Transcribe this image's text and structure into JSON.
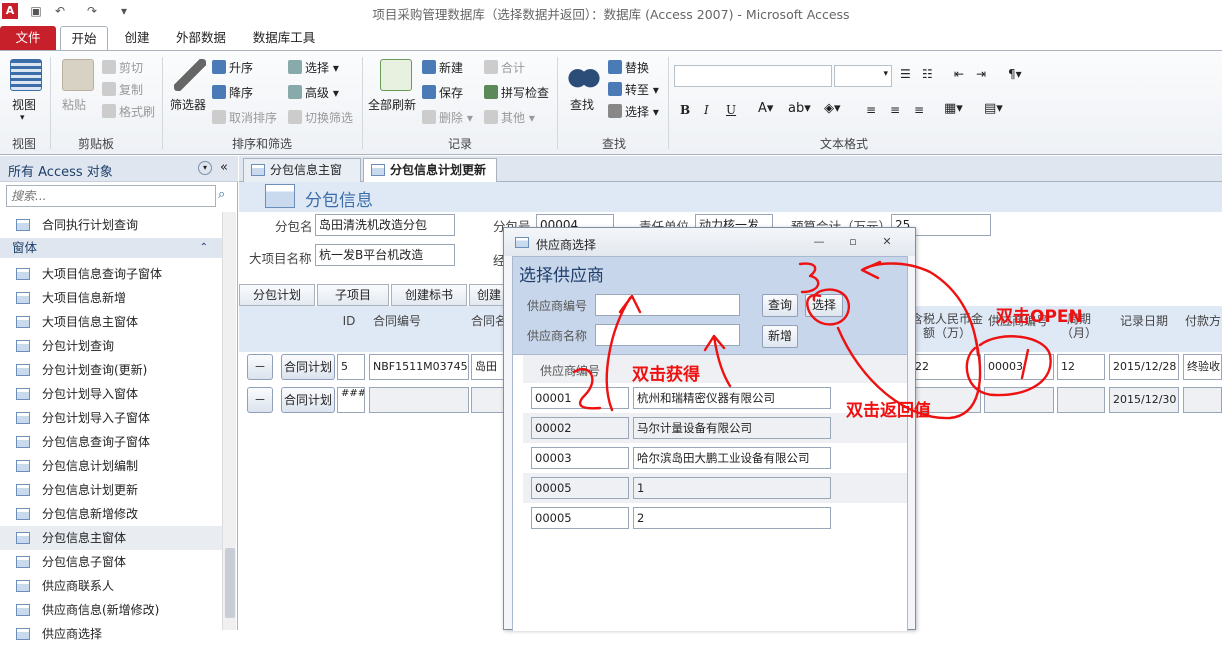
{
  "window": {
    "title": "项目采购管理数据库（选择数据并返回）：数据库 (Access 2007) - Microsoft Access"
  },
  "ribbon_tabs": [
    "文件",
    "开始",
    "创建",
    "外部数据",
    "数据库工具"
  ],
  "ribbon": {
    "view": {
      "label": "视图",
      "group": "视图"
    },
    "clipboard": {
      "paste": "粘贴",
      "cut": "剪切",
      "copy": "复制",
      "format_painter": "格式刷",
      "group": "剪贴板"
    },
    "sort_filter": {
      "filter": "筛选器",
      "asc": "升序",
      "desc": "降序",
      "remove_sort": "取消排序",
      "select": "选择",
      "advanced": "高级",
      "toggle_filter": "切换筛选",
      "group": "排序和筛选"
    },
    "records": {
      "refresh_all": "全部刷新",
      "new": "新建",
      "save": "保存",
      "delete": "删除",
      "totals": "合计",
      "spelling": "拼写检查",
      "more": "其他",
      "group": "记录"
    },
    "find": {
      "find": "查找",
      "replace": "替换",
      "goto": "转至",
      "select": "选择",
      "group": "查找"
    },
    "text_format": {
      "bold": "B",
      "italic": "I",
      "underline": "U",
      "group": "文本格式"
    }
  },
  "nav": {
    "header": "所有 Access 对象",
    "search_placeholder": "搜索...",
    "top_item": "合同执行计划查询",
    "section": "窗体",
    "items": [
      "大项目信息查询子窗体",
      "大项目信息新增",
      "大项目信息主窗体",
      "分包计划查询",
      "分包计划查询(更新)",
      "分包计划导入窗体",
      "分包计划导入子窗体",
      "分包信息查询子窗体",
      "分包信息计划编制",
      "分包信息计划更新",
      "分包信息新增修改",
      "分包信息主窗体",
      "分包信息子窗体",
      "供应商联系人",
      "供应商信息(新增修改)",
      "供应商选择"
    ]
  },
  "doc_tabs": [
    "分包信息主窗体",
    "分包信息计划更新"
  ],
  "form": {
    "title": "分包信息",
    "fields": {
      "sub_name_label": "分包名",
      "sub_name": "岛田清洗机改造分包",
      "sub_no_label": "分包号",
      "sub_no": "00004",
      "dept_label": "责任单位",
      "dept": "动力核一发",
      "budget_label": "预算合计（万元）",
      "budget": "25",
      "project_label": "大项目名称",
      "project": "杭一发B平台机改造",
      "partial_label": "经"
    },
    "buttons": [
      "分包计划",
      "子项目",
      "创建标书",
      "创建"
    ],
    "grid_headers": {
      "id": "ID",
      "contract_no": "合同编号",
      "contract_name": "合同名",
      "amount": "含税人民币金额（万）",
      "supplier_no": "供应商编号",
      "period": "周期（月）",
      "record_date": "记录日期",
      "payment": "付款方"
    },
    "rows": [
      {
        "minus": "－",
        "btn": "合同计划",
        "id": "5",
        "contract_no": "NBF1511M03745",
        "contract_name": "岛田",
        "amount": "22",
        "supplier_no": "00003",
        "period": "12",
        "record_date": "2015/12/28",
        "payment": "终验收"
      },
      {
        "minus": "－",
        "btn": "合同计划",
        "id": "###",
        "contract_no": "",
        "contract_name": "",
        "amount": "",
        "supplier_no": "",
        "period": "",
        "record_date": "2015/12/30",
        "payment": ""
      }
    ]
  },
  "popup": {
    "title": "供应商选择",
    "heading": "选择供应商",
    "no_label": "供应商编号",
    "name_label": "供应商名称",
    "query_btn": "查询",
    "select_btn": "选择",
    "new_btn": "新增",
    "list_header": "供应商编号",
    "rows": [
      {
        "no": "00001",
        "name": "杭州和瑞精密仪器有限公司"
      },
      {
        "no": "00002",
        "name": "马尔计量设备有限公司"
      },
      {
        "no": "00003",
        "name": "哈尔滨岛田大鹏工业设备有限公司"
      },
      {
        "no": "00005",
        "name": "1"
      },
      {
        "no": "00005",
        "name": "2"
      }
    ]
  },
  "annotations": {
    "open": "双击OPEN",
    "get": "双击获得",
    "return": "双击返回值",
    "n1": "1",
    "n2": "2",
    "n3": "3"
  },
  "colors": {
    "file_tab": "#c8202a",
    "annotation": "#e11111",
    "header_blue": "#dfe8f5",
    "popup_head": "#c7d6ea"
  }
}
